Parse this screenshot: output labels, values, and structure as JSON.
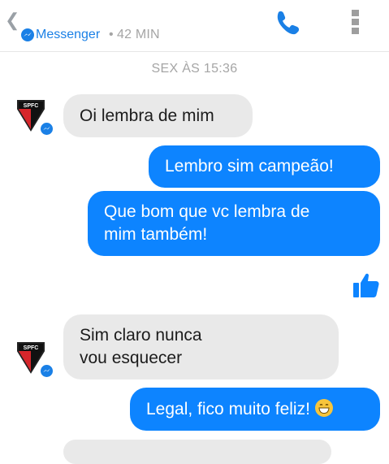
{
  "header": {
    "back_glyph": "❮",
    "app_name": "Messenger",
    "separator": "•",
    "last_seen": "42 MIN",
    "icons": [
      "back-chevron-icon",
      "messenger-logo-icon",
      "phone-icon",
      "more-options-icon"
    ]
  },
  "thread": {
    "timestamp": "SEX ÀS 15:36",
    "messages": [
      {
        "from": "them",
        "lines": [
          "Oi lembra de mim"
        ]
      },
      {
        "from": "me",
        "lines": [
          "Lembro sim campeão!"
        ]
      },
      {
        "from": "me",
        "lines": [
          "Que bom que vc lembra de",
          "mim também!"
        ]
      },
      {
        "from": "me",
        "type": "like",
        "icon": "thumbs-up-icon"
      },
      {
        "from": "them",
        "lines": [
          "Sim claro nunca",
          "vou esquecer"
        ]
      },
      {
        "from": "me",
        "lines": [
          "Legal, fico muito feliz!"
        ],
        "emoji": "grinning-face-icon"
      }
    ],
    "avatar": {
      "text": "SPFC",
      "icon": "spfc-shield-icon"
    }
  },
  "colors": {
    "accent": "#1a80e6",
    "outgoing_bubble": "#0d84ff",
    "incoming_bubble": "#e9e9e9",
    "muted_text": "#a5a5a5"
  }
}
